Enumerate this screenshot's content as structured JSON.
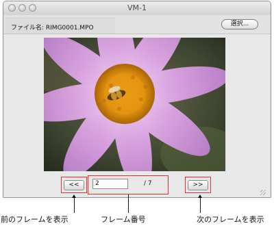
{
  "window": {
    "title": "VM-1"
  },
  "file": {
    "label": "ファイル名: RIMG0001.MPO",
    "select_label": "選択..."
  },
  "photo": {
    "description_icon": "cosmos-flower-with-bee-photo"
  },
  "frame_nav": {
    "prev_label": "<<",
    "next_label": ">>",
    "current_frame": "2",
    "total_label": "/  7"
  },
  "annotations": {
    "prev_caption": "前のフレームを表示",
    "frame_caption": "フレーム番号",
    "next_caption": "次のフレームを表示",
    "highlight_color": "#e53030"
  }
}
